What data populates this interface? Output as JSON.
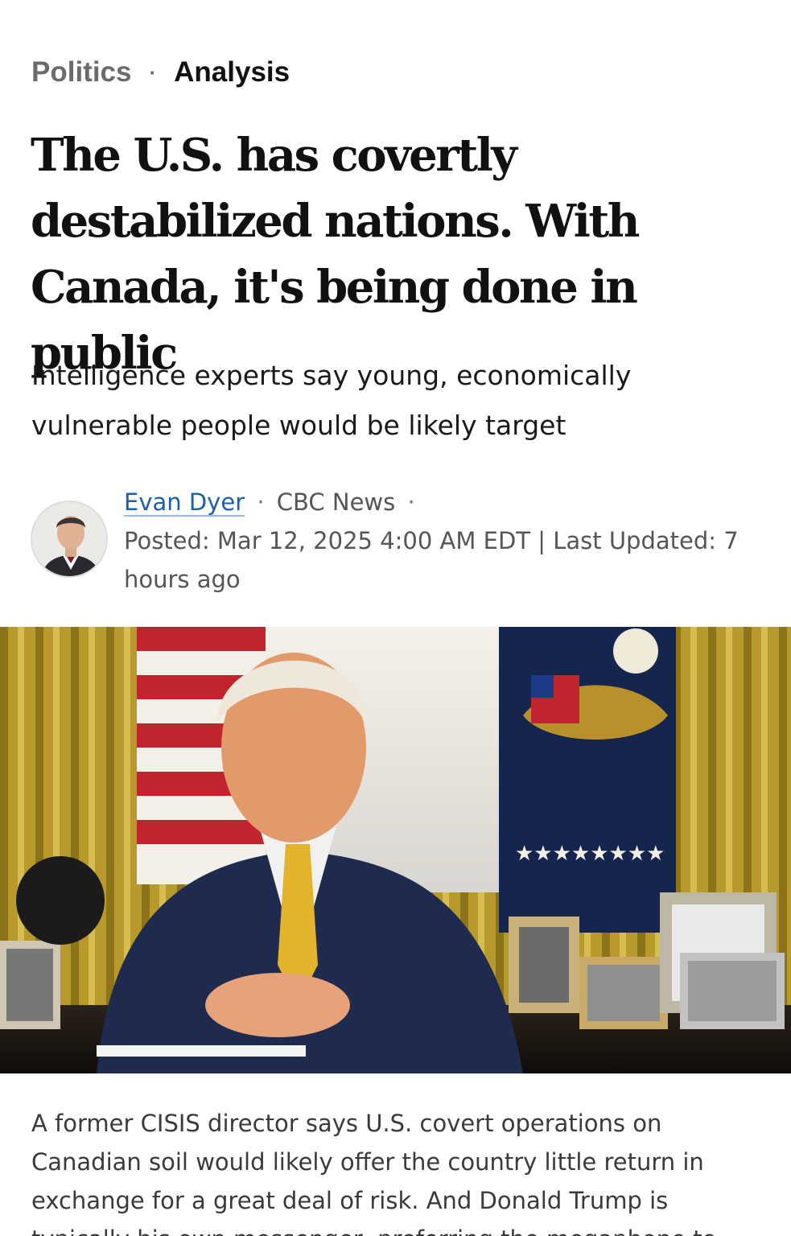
{
  "breadcrumb": {
    "section": "Politics",
    "separator": "·",
    "label": "Analysis"
  },
  "headline": "The U.S. has covertly destabilized nations. With Canada, it's being done in public",
  "dek": "Intelligence experts say young, economically vulnerable people would be likely target",
  "byline": {
    "author": "Evan Dyer",
    "sep1": "·",
    "outlet": "CBC News",
    "sep2": "·",
    "posted": "Posted: Mar 12, 2025 4:00 AM EDT | Last Updated: 7 hours ago"
  },
  "body": {
    "paragraph1": "A former CISIS director says U.S. covert operations on Canadian soil would likely offer the country little return in exchange for a great deal of risk. And Donald Trump is typically his own messenger, preferring the megaphone to"
  },
  "colors": {
    "link": "#1f5ea8",
    "headline": "#111111",
    "meta": "#555555"
  }
}
